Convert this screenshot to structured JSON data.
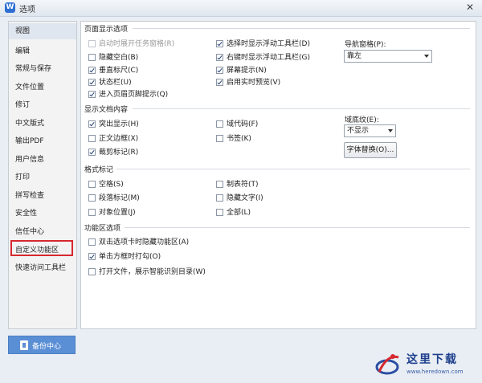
{
  "window": {
    "title": "选项",
    "app_icon": "W",
    "close_glyph": "✕"
  },
  "sidebar": {
    "items": [
      {
        "label": "视图",
        "active": true
      },
      {
        "label": "编辑"
      },
      {
        "label": "常规与保存"
      },
      {
        "label": "文件位置"
      },
      {
        "label": "修订"
      },
      {
        "label": "中文版式"
      },
      {
        "label": "输出PDF"
      },
      {
        "label": "用户信息"
      },
      {
        "label": "打印"
      },
      {
        "label": "拼写检查"
      },
      {
        "label": "安全性"
      },
      {
        "label": "信任中心"
      },
      {
        "label": "自定义功能区",
        "highlighted": true
      },
      {
        "label": "快速访问工具栏"
      }
    ],
    "backup_button": "备份中心"
  },
  "page_display": {
    "title": "页面显示选项",
    "left_options": [
      {
        "label": "启动时展开任务窗格(R)",
        "checked": false,
        "disabled": true
      },
      {
        "label": "隐藏空白(B)",
        "checked": false
      },
      {
        "label": "垂直标尺(C)",
        "checked": true
      },
      {
        "label": "状态栏(U)",
        "checked": true
      },
      {
        "label": "进入页眉页脚提示(Q)",
        "checked": true
      }
    ],
    "right_options": [
      {
        "label": "选择时显示浮动工具栏(D)",
        "checked": true
      },
      {
        "label": "右键时显示浮动工具栏(G)",
        "checked": true
      },
      {
        "label": "屏幕提示(N)",
        "checked": true
      },
      {
        "label": "启用实时预览(V)",
        "checked": true
      }
    ],
    "nav_pane_label": "导航窗格(P):",
    "nav_pane_value": "靠左"
  },
  "doc_content": {
    "title": "显示文档内容",
    "left_options": [
      {
        "label": "突出显示(H)",
        "checked": true
      },
      {
        "label": "正文边框(X)",
        "checked": false
      },
      {
        "label": "裁剪标记(R)",
        "checked": true
      }
    ],
    "right_options": [
      {
        "label": "域代码(F)",
        "checked": false
      },
      {
        "label": "书签(K)",
        "checked": false
      }
    ],
    "field_shading_label": "域底纹(E):",
    "field_shading_value": "不显示",
    "font_replace_button": "字体替换(O)..."
  },
  "format_marks": {
    "title": "格式标记",
    "left_options": [
      {
        "label": "空格(S)",
        "checked": false
      },
      {
        "label": "段落标记(M)",
        "checked": false
      },
      {
        "label": "对象位置(J)",
        "checked": false
      }
    ],
    "right_options": [
      {
        "label": "制表符(T)",
        "checked": false
      },
      {
        "label": "隐藏文字(I)",
        "checked": false
      },
      {
        "label": "全部(L)",
        "checked": false
      }
    ]
  },
  "ribbon": {
    "title": "功能区选项",
    "options": [
      {
        "label": "双击选项卡时隐藏功能区(A)",
        "checked": false
      },
      {
        "label": "单击方框时打勾(O)",
        "checked": true
      },
      {
        "label": "打开文件，展示智能识别目录(W)",
        "checked": false
      }
    ]
  },
  "watermark": {
    "title": "这里下载",
    "url": "www.heredown.com"
  },
  "colors": {
    "highlight_border": "#d7282f",
    "backup_button": "#5b8fd5",
    "app_icon": "#2f6fd4"
  }
}
